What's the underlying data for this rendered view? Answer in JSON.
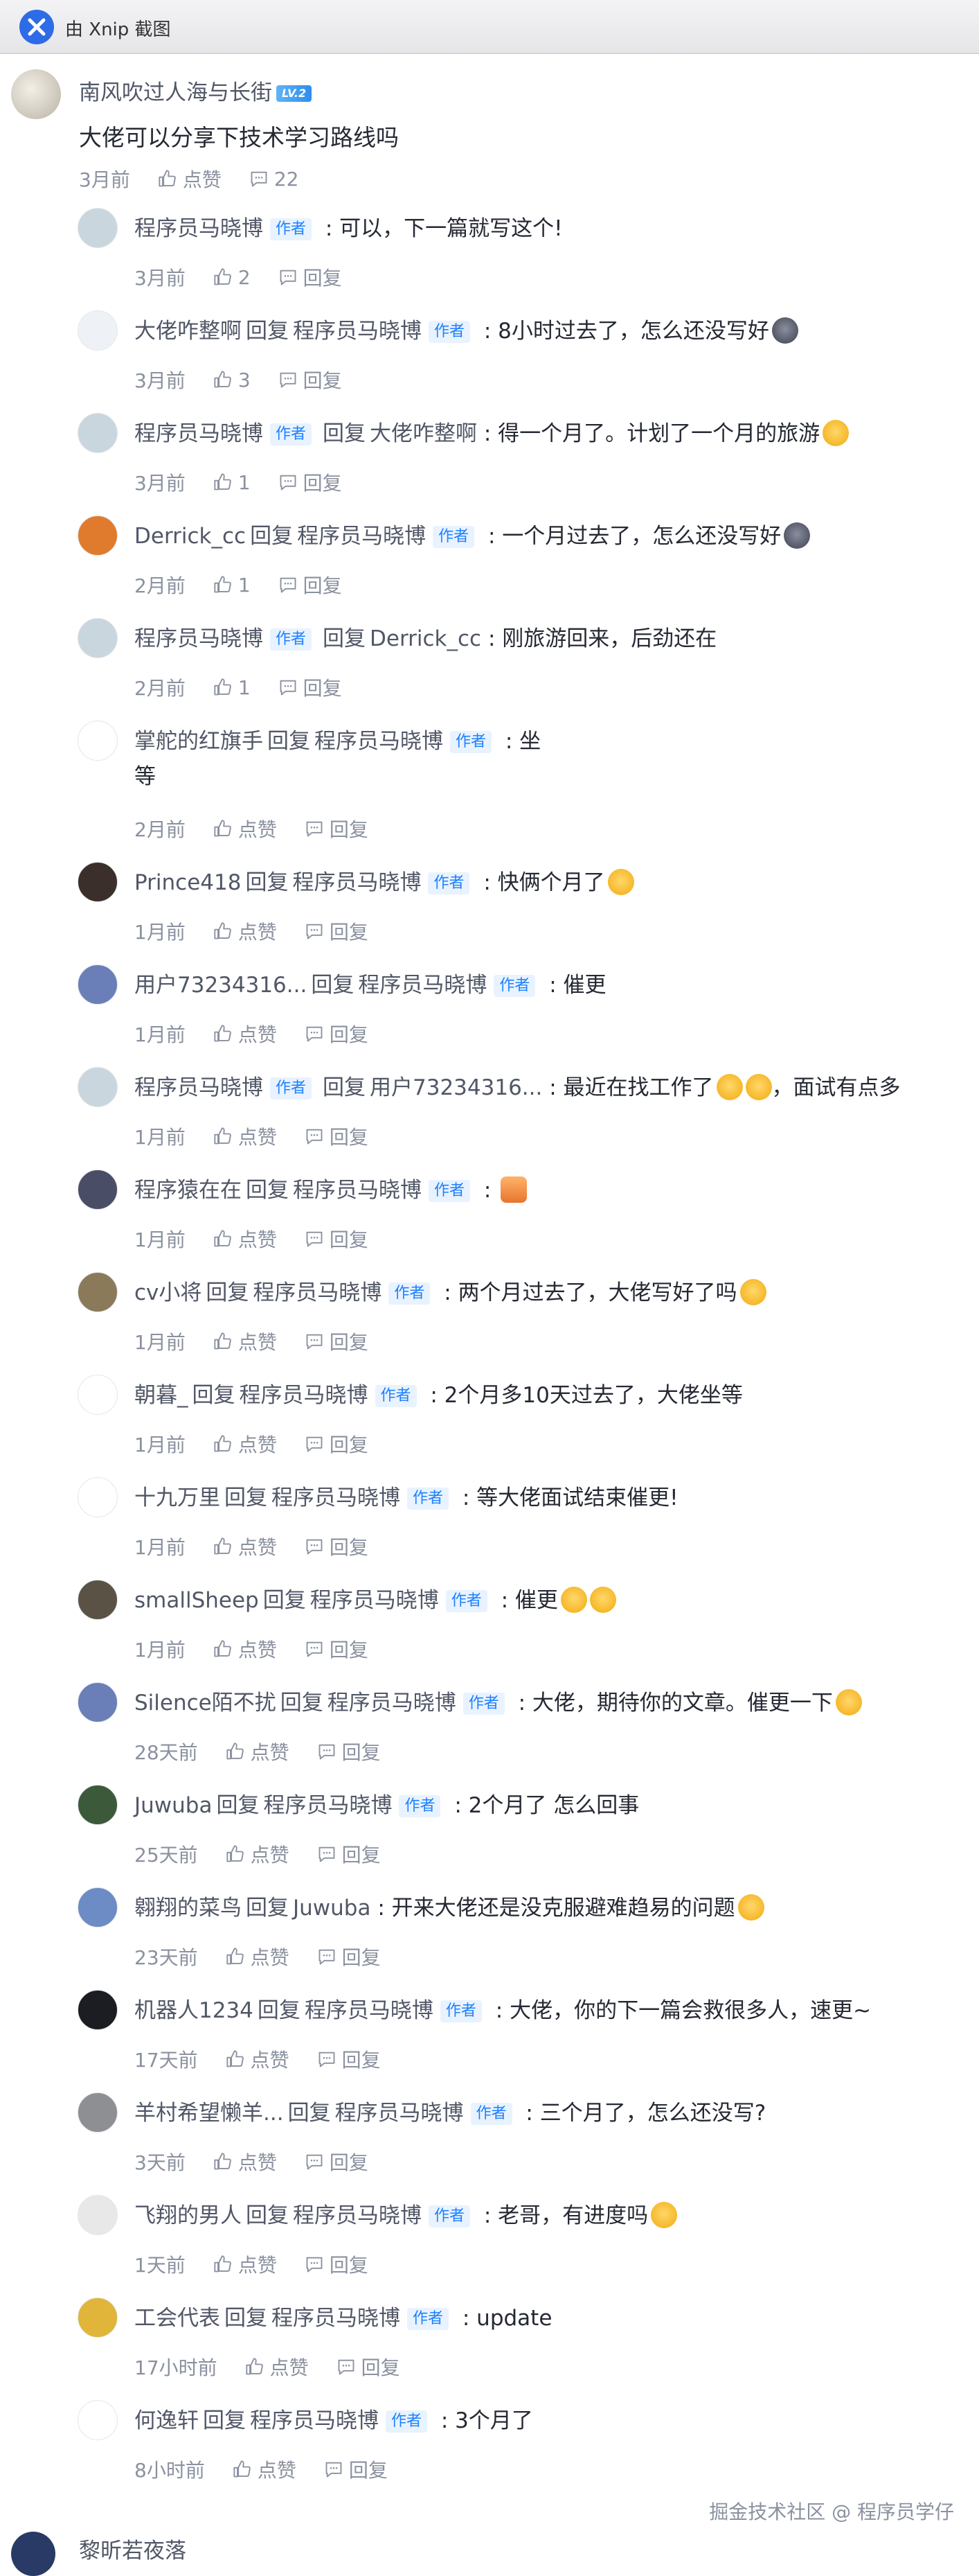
{
  "app": {
    "title": "由 Xnip 截图"
  },
  "root": {
    "username": "南风吹过人海与长街",
    "badge": "LV.2",
    "content": "大佬可以分享下技术学习路线吗",
    "time": "3月前",
    "like_label": "点赞",
    "comment_count": "22"
  },
  "tags": {
    "author": "作者",
    "reply_word": "回复",
    "reply_action": "回复"
  },
  "replies": [
    {
      "user": "程序员马晓博",
      "user_author": true,
      "target": "",
      "target_author": false,
      "content": "可以，下一篇就写这个!",
      "emoji": "",
      "time": "3月前",
      "likes": "2"
    },
    {
      "user": "大佬咋整啊",
      "user_author": false,
      "target": "程序员马晓博",
      "target_author": true,
      "content": "8小时过去了，怎么还没写好",
      "emoji": "cat",
      "time": "3月前",
      "likes": "3"
    },
    {
      "user": "程序员马晓博",
      "user_author": true,
      "target": "大佬咋整啊",
      "target_author": false,
      "content": "得一个月了。计划了一个月的旅游",
      "emoji": "think",
      "time": "3月前",
      "likes": "1"
    },
    {
      "user": "Derrick_cc",
      "user_author": false,
      "target": "程序员马晓博",
      "target_author": true,
      "content": "一个月过去了，怎么还没写好",
      "emoji": "cat",
      "time": "2月前",
      "likes": "1"
    },
    {
      "user": "程序员马晓博",
      "user_author": true,
      "target": "Derrick_cc",
      "target_author": false,
      "content": "刚旅游回来，后劲还在",
      "emoji": "",
      "time": "2月前",
      "likes": "1"
    },
    {
      "user": "掌舵的红旗手",
      "user_author": false,
      "target": "程序员马晓博",
      "target_author": true,
      "content": "坐",
      "content2": "等",
      "emoji": "",
      "time": "2月前",
      "likes": "点赞"
    },
    {
      "user": "Prince418",
      "user_author": false,
      "target": "程序员马晓博",
      "target_author": true,
      "content": "快俩个月了",
      "emoji": "face",
      "time": "1月前",
      "likes": "点赞"
    },
    {
      "user": "用户73234316...",
      "user_author": false,
      "target": "程序员马晓博",
      "target_author": true,
      "content": "催更",
      "emoji": "",
      "time": "1月前",
      "likes": "点赞"
    },
    {
      "user": "程序员马晓博",
      "user_author": true,
      "target": "用户73234316...",
      "target_author": false,
      "content": "最近在找工作了",
      "emoji": "sweat2",
      "content_after": "，面试有点多",
      "time": "1月前",
      "likes": "点赞"
    },
    {
      "user": "程序猿在在",
      "user_author": false,
      "target": "程序员马晓博",
      "target_author": true,
      "content": "",
      "emoji": "thumb",
      "time": "1月前",
      "likes": "点赞"
    },
    {
      "user": "cv小将",
      "user_author": false,
      "target": "程序员马晓博",
      "target_author": true,
      "content": "两个月过去了，大佬写好了吗",
      "emoji": "think",
      "time": "1月前",
      "likes": "点赞"
    },
    {
      "user": "朝暮_",
      "user_author": false,
      "target": "程序员马晓博",
      "target_author": true,
      "content": "2个月多10天过去了，大佬坐等",
      "emoji": "",
      "time": "1月前",
      "likes": "点赞"
    },
    {
      "user": "十九万里",
      "user_author": false,
      "target": "程序员马晓博",
      "target_author": true,
      "content": "等大佬面试结束催更!",
      "emoji": "",
      "time": "1月前",
      "likes": "点赞"
    },
    {
      "user": "smallSheep",
      "user_author": false,
      "target": "程序员马晓博",
      "target_author": true,
      "content": "催更",
      "emoji": "shock2",
      "time": "1月前",
      "likes": "点赞"
    },
    {
      "user": "Silence陌不扰",
      "user_author": false,
      "target": "程序员马晓博",
      "target_author": true,
      "content": "大佬，期待你的文章。催更一下",
      "emoji": "face",
      "time": "28天前",
      "likes": "点赞"
    },
    {
      "user": "Juwuba",
      "user_author": false,
      "target": "程序员马晓博",
      "target_author": true,
      "content": "2个月了 怎么回事",
      "emoji": "",
      "time": "25天前",
      "likes": "点赞"
    },
    {
      "user": "翱翔的菜鸟",
      "user_author": false,
      "target": "Juwuba",
      "target_author": false,
      "content": "开来大佬还是没克服避难趋易的问题",
      "emoji": "face",
      "time": "23天前",
      "likes": "点赞"
    },
    {
      "user": "机器人1234",
      "user_author": false,
      "target": "程序员马晓博",
      "target_author": true,
      "content": "大佬，你的下一篇会救很多人，速更~",
      "emoji": "",
      "time": "17天前",
      "likes": "点赞"
    },
    {
      "user": "羊村希望懒羊...",
      "user_author": false,
      "target": "程序员马晓博",
      "target_author": true,
      "content": "三个月了，怎么还没写?",
      "emoji": "",
      "time": "3天前",
      "likes": "点赞"
    },
    {
      "user": "飞翔的男人",
      "user_author": false,
      "target": "程序员马晓博",
      "target_author": true,
      "content": "老哥，有进度吗",
      "emoji": "face",
      "time": "1天前",
      "likes": "点赞"
    },
    {
      "user": "工会代表",
      "user_author": false,
      "target": "程序员马晓博",
      "target_author": true,
      "content": "update",
      "emoji": "",
      "time": "17小时前",
      "likes": "点赞"
    },
    {
      "user": "何逸轩",
      "user_author": false,
      "target": "程序员马晓博",
      "target_author": true,
      "content": "3个月了",
      "emoji": "",
      "time": "8小时前",
      "likes": "点赞"
    }
  ],
  "watermark": "掘金技术社区 @ 程序员学仔",
  "next_comment": {
    "username": "黎昕若夜落"
  },
  "colors": {
    "author_tag_bg": "#e8f3ff",
    "author_tag_fg": "#1e80ff",
    "muted": "#8a919f",
    "text": "#252933"
  }
}
